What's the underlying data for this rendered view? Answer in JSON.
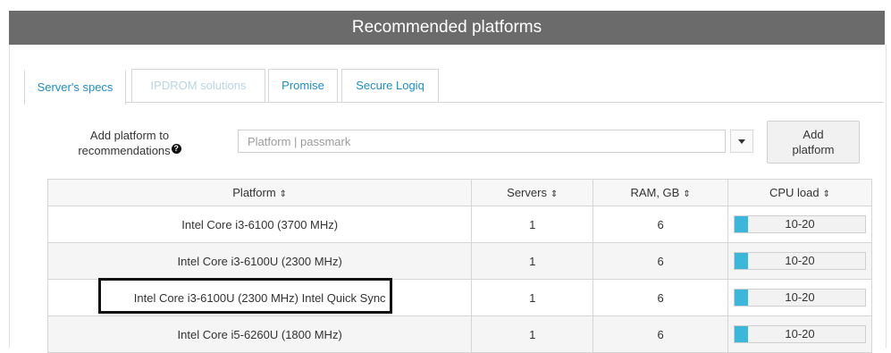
{
  "header": {
    "title": "Recommended platforms"
  },
  "tabs": [
    {
      "label": "Server's specs",
      "state": "active"
    },
    {
      "label": "IPDROM solutions",
      "state": "disabled"
    },
    {
      "label": "Promise",
      "state": "normal"
    },
    {
      "label": "Secure Logiq",
      "state": "normal"
    }
  ],
  "add_form": {
    "label_line1": "Add platform to",
    "label_line2": "recommendations",
    "help_icon": "question-circle-icon",
    "input_placeholder": "Platform | passmark",
    "dropdown_icon": "caret-down-icon",
    "button_line1": "Add",
    "button_line2": "platform"
  },
  "table": {
    "columns": [
      "Platform",
      "Servers",
      "RAM, GB",
      "CPU load"
    ],
    "sort_icon": "⇕",
    "rows": [
      {
        "platform": "Intel Core i3-6100 (3700 MHz)",
        "servers": "1",
        "ram": "6",
        "cpu_load": "10-20",
        "cpu_fill": 0.1
      },
      {
        "platform": "Intel Core i3-6100U (2300 MHz)",
        "servers": "1",
        "ram": "6",
        "cpu_load": "10-20",
        "cpu_fill": 0.1
      },
      {
        "platform": "Intel Core i3-6100U (2300 MHz) Intel Quick Sync",
        "servers": "1",
        "ram": "6",
        "cpu_load": "10-20",
        "cpu_fill": 0.1
      },
      {
        "platform": "Intel Core i5-6260U (1800 MHz)",
        "servers": "1",
        "ram": "6",
        "cpu_load": "10-20",
        "cpu_fill": 0.1
      }
    ]
  },
  "colors": {
    "accent": "#1f8ec6",
    "load_fill": "#3cb7dc",
    "title_bg": "#6b6b6b"
  }
}
